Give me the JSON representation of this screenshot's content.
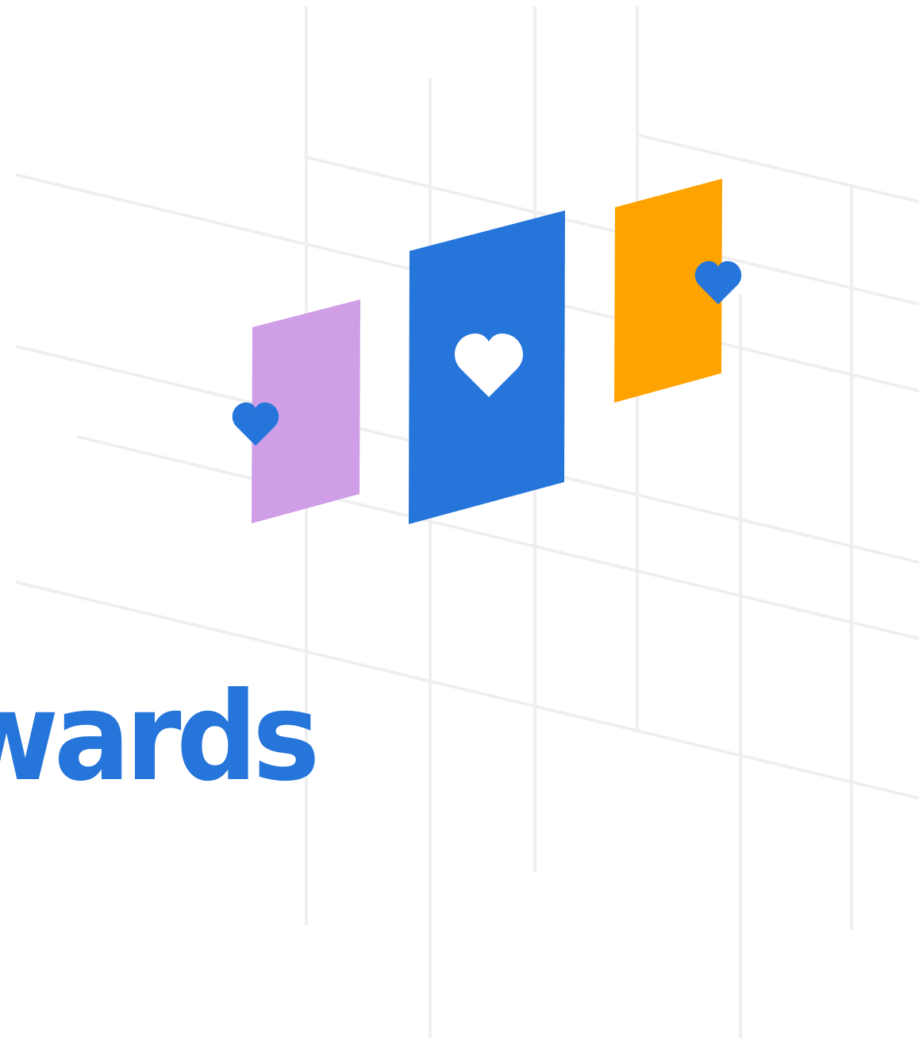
{
  "headline": {
    "text": "wards"
  },
  "colors": {
    "brand_blue": "#2575DA",
    "lavender": "#CF9EE6",
    "orange": "#FFA300",
    "grid": "#EFEFEF",
    "background": "#FFFFFF",
    "heart_white": "#FFFFFF"
  },
  "icons": {
    "card_left": "heart-icon",
    "card_center": "heart-icon",
    "card_right": "heart-icon"
  }
}
